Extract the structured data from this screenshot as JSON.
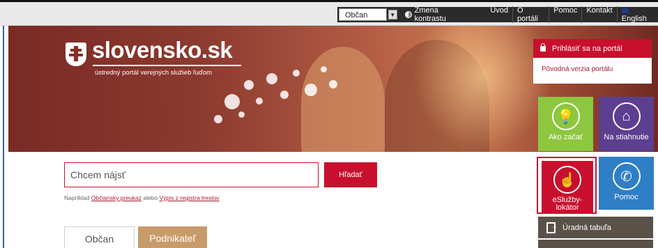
{
  "utility_bar": {
    "role_select": "Občan",
    "contrast_label": "Zmena kontrastu",
    "nav": [
      "Úvod",
      "O portáli",
      "Pomoc",
      "Kontakt",
      "English"
    ]
  },
  "hero": {
    "logo_text": "slovensko.sk",
    "tagline": "ústredný portál verejných služieb ľuďom"
  },
  "login": {
    "button": "Prihlásiť sa na portál",
    "original_version": "Pôvodná verzia portálu"
  },
  "tiles": {
    "ako_zacat": "Ako začať",
    "na_stiahnutie": "Na stiahnutie",
    "esluzby_line1": "eSlužby-",
    "esluzby_line2": "lokátor",
    "pomoc": "Pomoc",
    "uradna_tabula": "Úradná tabuľa"
  },
  "search": {
    "placeholder": "Chcem nájsť",
    "button": "Hľadať",
    "example_prefix": "Napríklad ",
    "example_link1": "Občiansky preukaz",
    "example_mid": " alebo ",
    "example_link2": "Výpis z registra trestov"
  },
  "tabs": [
    "Občan",
    "Podnikateľ"
  ],
  "colors": {
    "brand_red": "#c8102e",
    "tile_green": "#8dc63f",
    "tile_purple": "#5c3f91",
    "tile_blue": "#2f7fc6",
    "tab_tan": "#c89b6a",
    "tabula_brown": "#5a5249"
  },
  "icons": [
    "lightbulb-icon",
    "house-download-icon",
    "person-pointer-icon",
    "phone-icon",
    "lock-icon",
    "document-exit-icon",
    "contrast-icon",
    "uk-flag-icon"
  ]
}
